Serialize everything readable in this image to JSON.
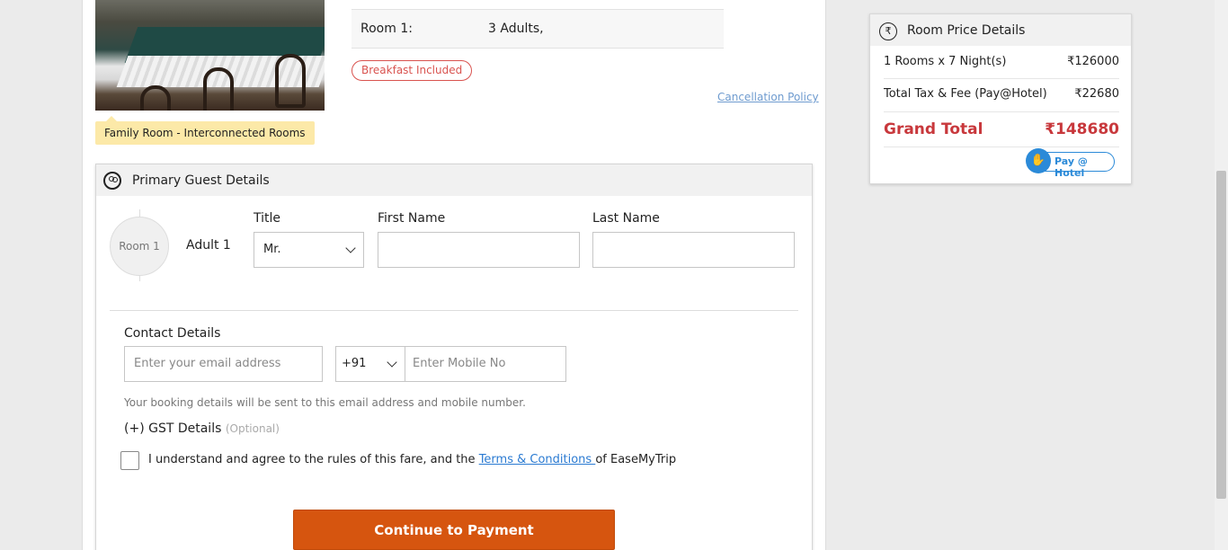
{
  "room": {
    "tag": "Family Room - Interconnected Rooms",
    "occupancy_label": "Room 1:",
    "occupancy_value": "3 Adults,",
    "breakfast": "Breakfast Included",
    "cancellation_link": "Cancellation Policy"
  },
  "guest": {
    "title": "Primary Guest Details",
    "room_badge": "Room 1",
    "adult_label": "Adult 1",
    "title_label": "Title",
    "title_value": "Mr.",
    "first_name_label": "First Name",
    "last_name_label": "Last Name",
    "contact_label": "Contact Details",
    "email_placeholder": "Enter your email address",
    "country_code": "+91",
    "mobile_placeholder": "Enter Mobile No",
    "hint": "Your booking details will be sent to this email address and mobile number.",
    "gst_label": "(+) GST Details",
    "gst_optional": "(Optional)",
    "agree_prefix": "I understand and agree to the rules of this fare, and the ",
    "agree_link": "Terms & Conditions ",
    "agree_suffix": "of EaseMyTrip",
    "continue_button": "Continue to Payment"
  },
  "price": {
    "title": "Room Price Details",
    "rupee_icon": "₹",
    "rooms_label": "1 Rooms x 7 Night(s)",
    "rooms_value": "₹126000",
    "tax_label": "Total Tax & Fee (Pay@Hotel)",
    "tax_value": "₹22680",
    "grand_label": "Grand Total",
    "grand_value": "₹148680",
    "pay_badge": "Pay @ Hotel"
  }
}
